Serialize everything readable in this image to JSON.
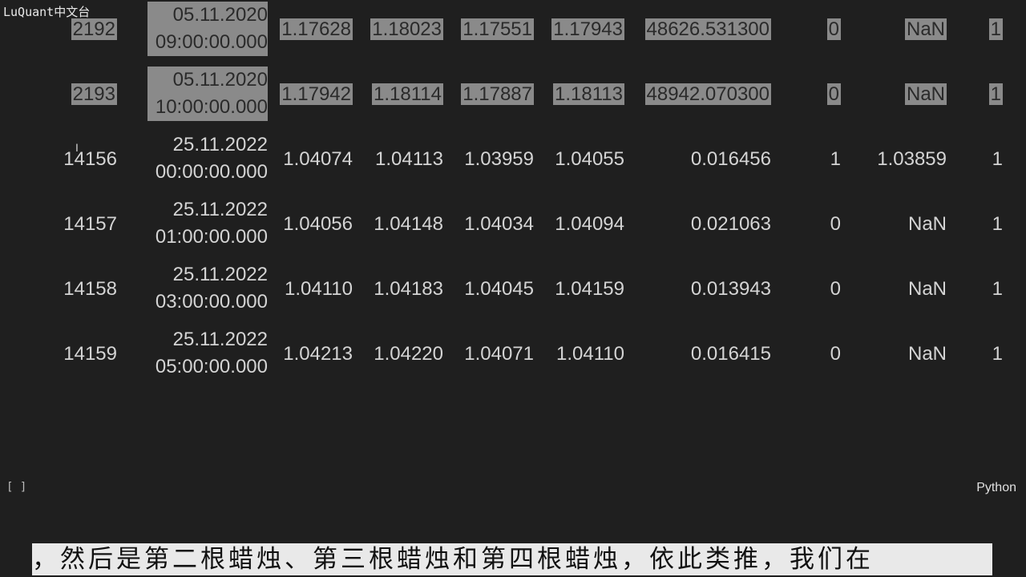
{
  "watermark": "LuQuant中文台",
  "rows": [
    {
      "idx": "2192",
      "date": "05.11.2020",
      "time": "09:00:00.000",
      "o": "1.17628",
      "h": "1.18023",
      "l": "1.17551",
      "c": "1.17943",
      "v": "48626.531300",
      "s": "0",
      "p": "NaN",
      "t": "1",
      "sel": true
    },
    {
      "idx": "2193",
      "date": "05.11.2020",
      "time": "10:00:00.000",
      "o": "1.17942",
      "h": "1.18114",
      "l": "1.17887",
      "c": "1.18113",
      "v": "48942.070300",
      "s": "0",
      "p": "NaN",
      "t": "1",
      "sel": true
    },
    {
      "idx": "14156",
      "date": "25.11.2022",
      "time": "00:00:00.000",
      "o": "1.04074",
      "h": "1.04113",
      "l": "1.03959",
      "c": "1.04055",
      "v": "0.016456",
      "s": "1",
      "p": "1.03859",
      "t": "1",
      "sel": false
    },
    {
      "idx": "14157",
      "date": "25.11.2022",
      "time": "01:00:00.000",
      "o": "1.04056",
      "h": "1.04148",
      "l": "1.04034",
      "c": "1.04094",
      "v": "0.021063",
      "s": "0",
      "p": "NaN",
      "t": "1",
      "sel": false
    },
    {
      "idx": "14158",
      "date": "25.11.2022",
      "time": "03:00:00.000",
      "o": "1.04110",
      "h": "1.04183",
      "l": "1.04045",
      "c": "1.04159",
      "v": "0.013943",
      "s": "0",
      "p": "NaN",
      "t": "1",
      "sel": false
    },
    {
      "idx": "14159",
      "date": "25.11.2022",
      "time": "05:00:00.000",
      "o": "1.04213",
      "h": "1.04220",
      "l": "1.04071",
      "c": "1.04110",
      "v": "0.016415",
      "s": "0",
      "p": "NaN",
      "t": "1",
      "sel": false
    }
  ],
  "cell_bracket": "[ ]",
  "language": "Python",
  "subtitle": "，然后是第二根蜡烛、第三根蜡烛和第四根蜡烛，依此类推，我们在"
}
